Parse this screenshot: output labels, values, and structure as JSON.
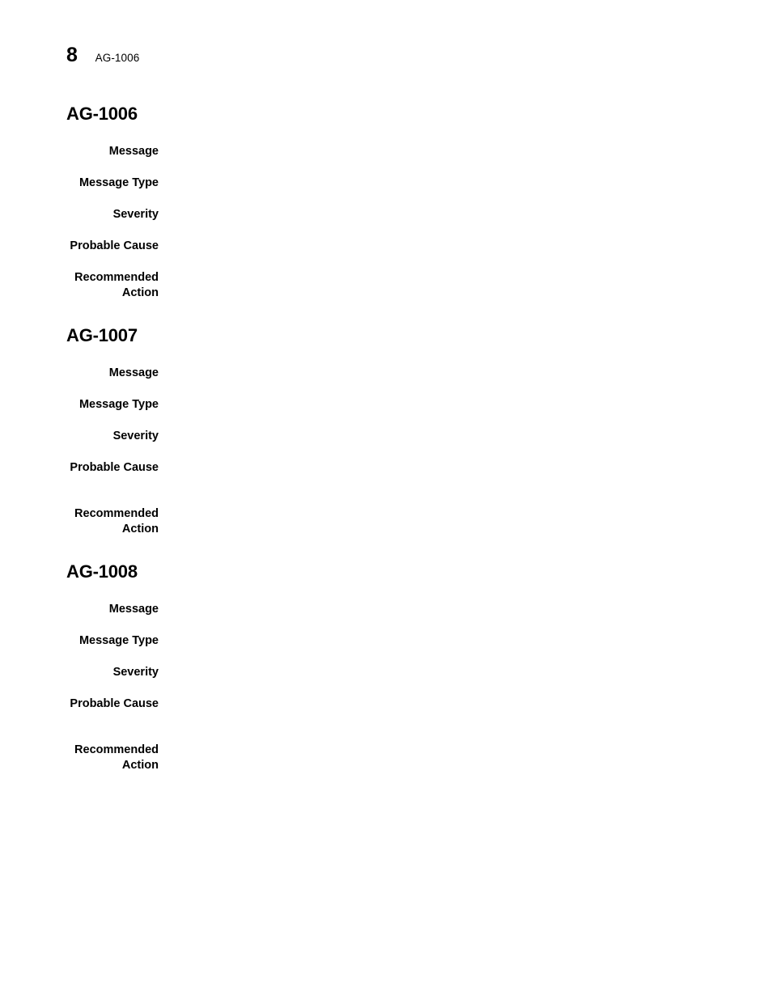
{
  "page": {
    "folio": "8",
    "running_head": "AG-1006"
  },
  "field_labels": {
    "message": "Message",
    "message_type": "Message Type",
    "severity": "Severity",
    "probable_cause": "Probable Cause",
    "recommended_action": "Recommended\nAction"
  },
  "sections": [
    {
      "heading": "AG-1006",
      "fields": [
        {
          "label": "Message",
          "value": ""
        },
        {
          "label": "Message Type",
          "value": ""
        },
        {
          "label": "Severity",
          "value": ""
        },
        {
          "label": "Probable Cause",
          "value": ""
        },
        {
          "label": "Recommended\nAction",
          "value": ""
        }
      ]
    },
    {
      "heading": "AG-1007",
      "fields": [
        {
          "label": "Message",
          "value": ""
        },
        {
          "label": "Message Type",
          "value": ""
        },
        {
          "label": "Severity",
          "value": ""
        },
        {
          "label": "Probable Cause",
          "value": ""
        },
        {
          "label": "Recommended\nAction",
          "value": ""
        }
      ]
    },
    {
      "heading": "AG-1008",
      "fields": [
        {
          "label": "Message",
          "value": ""
        },
        {
          "label": "Message Type",
          "value": ""
        },
        {
          "label": "Severity",
          "value": ""
        },
        {
          "label": "Probable Cause",
          "value": ""
        },
        {
          "label": "Recommended\nAction",
          "value": ""
        }
      ]
    }
  ],
  "colors": {
    "text": "#000000",
    "background": "#ffffff"
  }
}
